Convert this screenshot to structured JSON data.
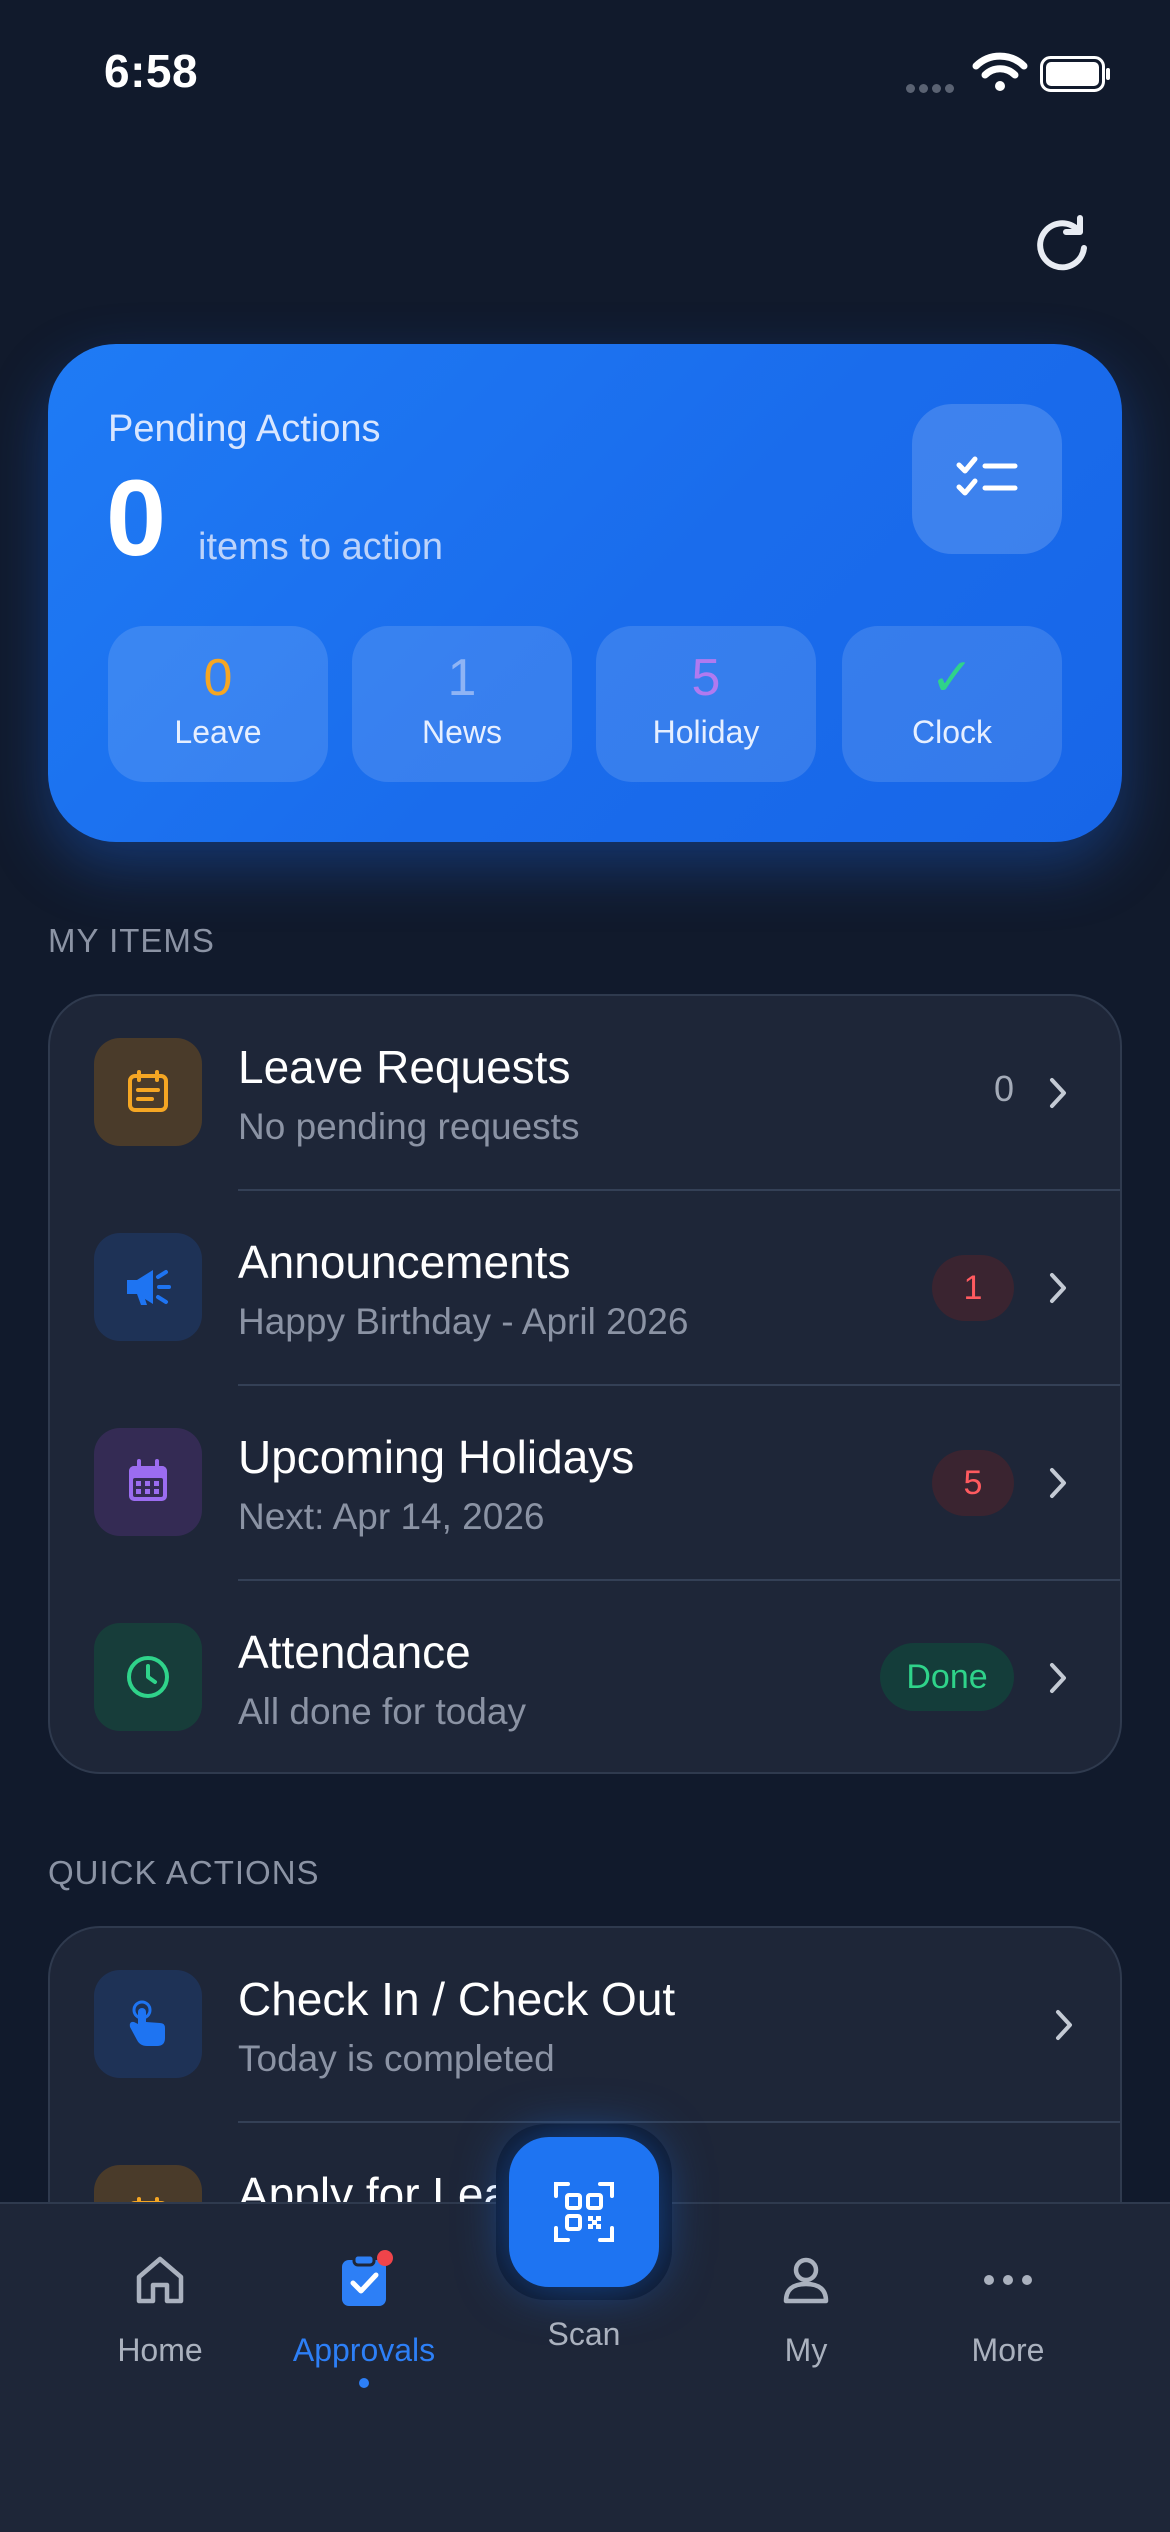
{
  "status_bar": {
    "time": "6:58"
  },
  "pending": {
    "title": "Pending Actions",
    "count": "0",
    "subtitle": "items to action",
    "stats": [
      {
        "value": "0",
        "label": "Leave",
        "color": "#f5a623"
      },
      {
        "value": "1",
        "label": "News",
        "color": "#8fb4f5"
      },
      {
        "value": "5",
        "label": "Holiday",
        "color": "#b07af0"
      },
      {
        "value": "✓",
        "label": "Clock",
        "color": "#2fd38a"
      }
    ]
  },
  "my_items": {
    "section_label": "MY ITEMS",
    "rows": [
      {
        "title": "Leave Requests",
        "subtitle": "No pending requests",
        "count": "0",
        "icon": "calendar-note-icon",
        "accent": "#f5a623"
      },
      {
        "title": "Announcements",
        "subtitle": "Happy Birthday - April 2026",
        "badge": "1",
        "icon": "megaphone-icon",
        "accent": "#1e74f2"
      },
      {
        "title": "Upcoming Holidays",
        "subtitle": "Next: Apr 14, 2026",
        "badge": "5",
        "icon": "calendar-grid-icon",
        "accent": "#9b6cf0"
      },
      {
        "title": "Attendance",
        "subtitle": "All done for today",
        "badge": "Done",
        "icon": "clock-icon",
        "accent": "#2fd38a"
      }
    ]
  },
  "quick_actions": {
    "section_label": "QUICK ACTIONS",
    "rows": [
      {
        "title": "Check In / Check Out",
        "subtitle": "Today is completed",
        "icon": "tap-hand-icon",
        "accent": "#1e74f2"
      },
      {
        "title": "Apply for Leave",
        "icon": "calendar-icon",
        "accent": "#f5a623"
      }
    ]
  },
  "nav": {
    "home": "Home",
    "approvals": "Approvals",
    "scan": "Scan",
    "my": "My",
    "more": "More",
    "active": "approvals"
  }
}
